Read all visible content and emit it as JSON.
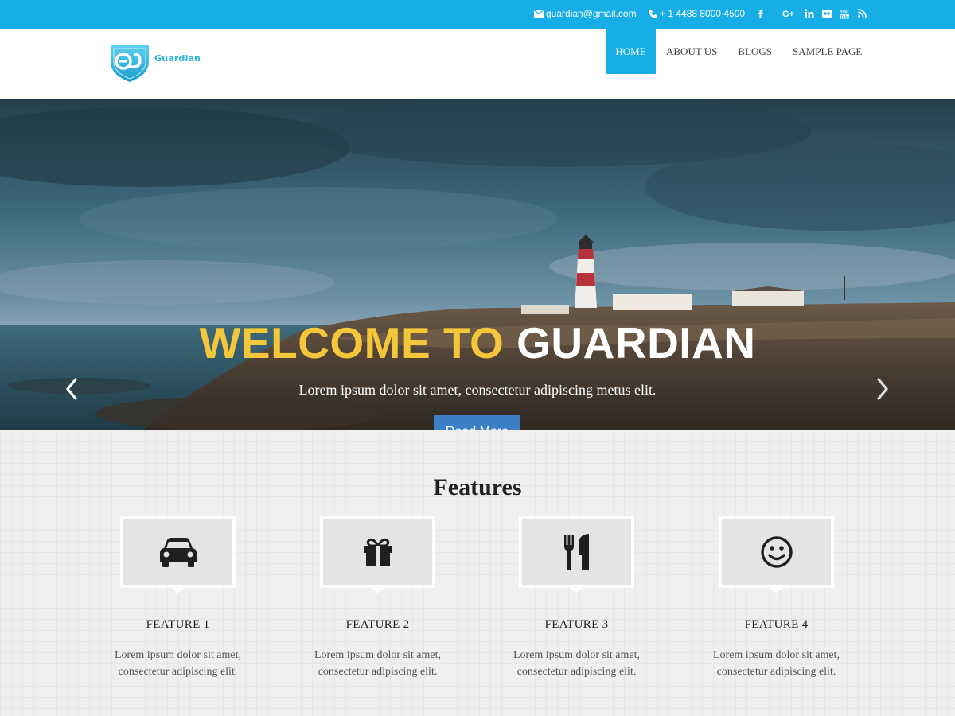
{
  "topbar": {
    "email": "guardian@gmail.com",
    "phone": "+ 1 4488 8000 4500",
    "social_icons": [
      "facebook-icon",
      "google-plus-icon",
      "linkedin-icon",
      "flickr-icon",
      "youtube-icon",
      "rss-icon"
    ],
    "background": "#17aee8"
  },
  "header": {
    "logo_text": "Guardian",
    "nav": [
      "HOME",
      "ABOUT US",
      "BLOGS",
      "SAMPLE PAGE"
    ],
    "active_nav": "HOME",
    "accent": "#17aee8"
  },
  "hero": {
    "title_part1": "WELCOME TO",
    "title_part2": "GUARDIAN",
    "subtitle": "Lorem ipsum dolor sit amet, consectetur adipiscing metus elit.",
    "button_label": "Read More",
    "title_accent": "#f4c63a",
    "button_color": "#3b7fc4"
  },
  "features": {
    "heading": "Features",
    "items": [
      {
        "icon": "car-icon",
        "title": "FEATURE 1",
        "text_line1": "Lorem ipsum dolor sit amet,",
        "text_line2": "consectetur adipiscing elit."
      },
      {
        "icon": "gift-icon",
        "title": "FEATURE 2",
        "text_line1": "Lorem ipsum dolor sit amet,",
        "text_line2": "consectetur adipiscing elit."
      },
      {
        "icon": "cutlery-icon",
        "title": "FEATURE 3",
        "text_line1": "Lorem ipsum dolor sit amet,",
        "text_line2": "consectetur adipiscing elit."
      },
      {
        "icon": "smile-icon",
        "title": "FEATURE 4",
        "text_line1": "Lorem ipsum dolor sit amet,",
        "text_line2": "consectetur adipiscing elit."
      }
    ]
  }
}
